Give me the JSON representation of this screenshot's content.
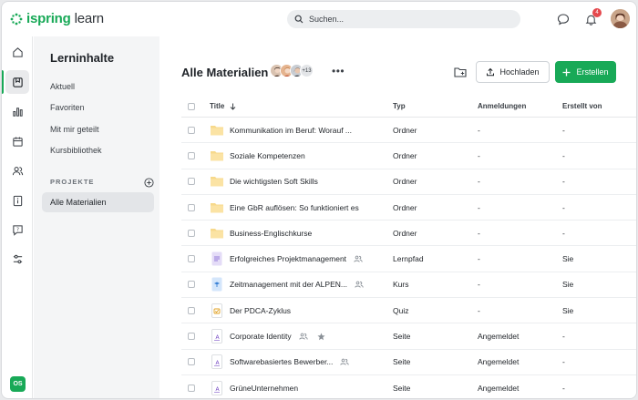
{
  "app": {
    "logo_text_green": "ispring",
    "logo_text_rest": "learn",
    "brand_color": "#18a957"
  },
  "search": {
    "placeholder": "Suchen..."
  },
  "notifications": {
    "count": "4"
  },
  "user": {
    "initials": "OS"
  },
  "sidebar": {
    "title": "Lerninhalte",
    "links": [
      "Aktuell",
      "Favoriten",
      "Mit mir geteilt",
      "Kursbibliothek"
    ],
    "section": "PROJEKTE",
    "selected": "Alle Materialien"
  },
  "main": {
    "title": "Alle Materialien",
    "members_more": "+13",
    "upload_label": "Hochladen",
    "create_label": "Erstellen"
  },
  "table": {
    "columns": {
      "title": "Title",
      "type": "Typ",
      "registrations": "Anmeldungen",
      "created_by": "Erstellt von"
    },
    "rows": [
      {
        "icon": "folder",
        "title": "Kommunikation im Beruf: Worauf ...",
        "type": "Ordner",
        "reg": "-",
        "by": "-"
      },
      {
        "icon": "folder",
        "title": "Soziale Kompetenzen",
        "type": "Ordner",
        "reg": "-",
        "by": "-"
      },
      {
        "icon": "folder",
        "title": "Die wichtigsten Soft Skills",
        "type": "Ordner",
        "reg": "-",
        "by": "-"
      },
      {
        "icon": "folder",
        "title": "Eine GbR auflösen: So funktioniert es",
        "type": "Ordner",
        "reg": "-",
        "by": "-"
      },
      {
        "icon": "folder",
        "title": "Business-Englischkurse",
        "type": "Ordner",
        "reg": "-",
        "by": "-"
      },
      {
        "icon": "learning-path",
        "title": "Erfolgreiches Projektmanagement",
        "type": "Lernpfad",
        "reg": "-",
        "by": "Sie",
        "shared": true
      },
      {
        "icon": "course",
        "title": "Zeitmanagement mit der ALPEN...",
        "type": "Kurs",
        "reg": "-",
        "by": "Sie",
        "shared": true
      },
      {
        "icon": "quiz",
        "title": "Der PDCA-Zyklus",
        "type": "Quiz",
        "reg": "-",
        "by": "Sie"
      },
      {
        "icon": "page",
        "title": "Corporate Identity",
        "type": "Seite",
        "reg": "Angemeldet",
        "by": "-",
        "shared": true,
        "starred": true
      },
      {
        "icon": "page",
        "title": "Softwarebasiertes Bewerber...",
        "type": "Seite",
        "reg": "Angemeldet",
        "by": "-",
        "shared": true
      },
      {
        "icon": "page",
        "title": "GrüneUnternehmen",
        "type": "Seite",
        "reg": "Angemeldet",
        "by": "-"
      }
    ]
  }
}
